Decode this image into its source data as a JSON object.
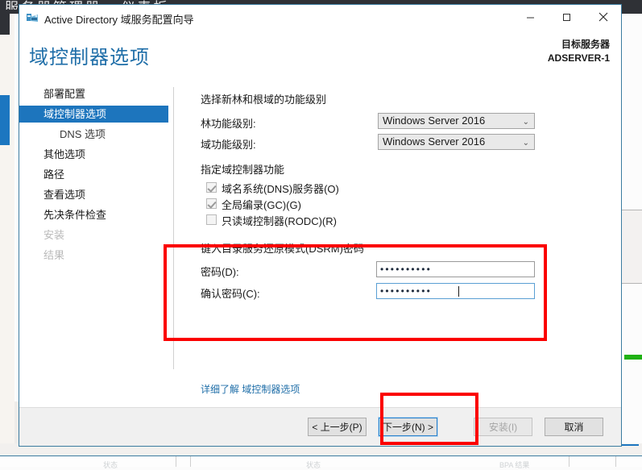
{
  "background": {
    "app_title": "服务器管理器 • 仪表板",
    "bottom_labels": [
      "状态",
      "状态",
      "BPA 结果"
    ]
  },
  "window": {
    "title": "Active Directory 域服务配置向导",
    "icon": "active-directory-icon",
    "controls": {
      "minimize": "minimize-icon",
      "maximize": "maximize-icon",
      "close": "close-icon"
    }
  },
  "header": {
    "page_title": "域控制器选项",
    "target_server_label": "目标服务器",
    "target_server_name": "ADSERVER-1"
  },
  "sidebar": {
    "items": [
      {
        "label": "部署配置",
        "state": "normal"
      },
      {
        "label": "域控制器选项",
        "state": "selected"
      },
      {
        "label": "DNS 选项",
        "state": "sub"
      },
      {
        "label": "其他选项",
        "state": "normal"
      },
      {
        "label": "路径",
        "state": "normal"
      },
      {
        "label": "查看选项",
        "state": "normal"
      },
      {
        "label": "先决条件检查",
        "state": "normal"
      },
      {
        "label": "安装",
        "state": "disabled"
      },
      {
        "label": "结果",
        "state": "disabled"
      }
    ]
  },
  "content": {
    "functional_level_heading": "选择新林和根域的功能级别",
    "forest_level_label": "林功能级别:",
    "forest_level_value": "Windows Server 2016",
    "domain_level_label": "域功能级别:",
    "domain_level_value": "Windows Server 2016",
    "capabilities_heading": "指定域控制器功能",
    "checkboxes": [
      {
        "label": "域名系统(DNS)服务器(O)",
        "checked": true
      },
      {
        "label": "全局编录(GC)(G)",
        "checked": true
      },
      {
        "label": "只读域控制器(RODC)(R)",
        "checked": false
      }
    ],
    "dsrm_heading": "键入目录服务还原模式(DSRM)密码",
    "password_label": "密码(D):",
    "password_value": "••••••••••",
    "confirm_label": "确认密码(C):",
    "confirm_value": "••••••••••",
    "more_link": "详细了解 域控制器选项"
  },
  "footer": {
    "previous": "< 上一步(P)",
    "next": "下一步(N) >",
    "install": "安装(I)",
    "cancel": "取消"
  },
  "annotations": {
    "password_highlight": "red-highlight-box",
    "next_highlight": "red-highlight-box"
  },
  "colors": {
    "accent_blue": "#1d75bd",
    "title_blue": "#1f6ea8",
    "annotation_red": "#fb0000",
    "focus_blue": "#5a9fd4"
  }
}
